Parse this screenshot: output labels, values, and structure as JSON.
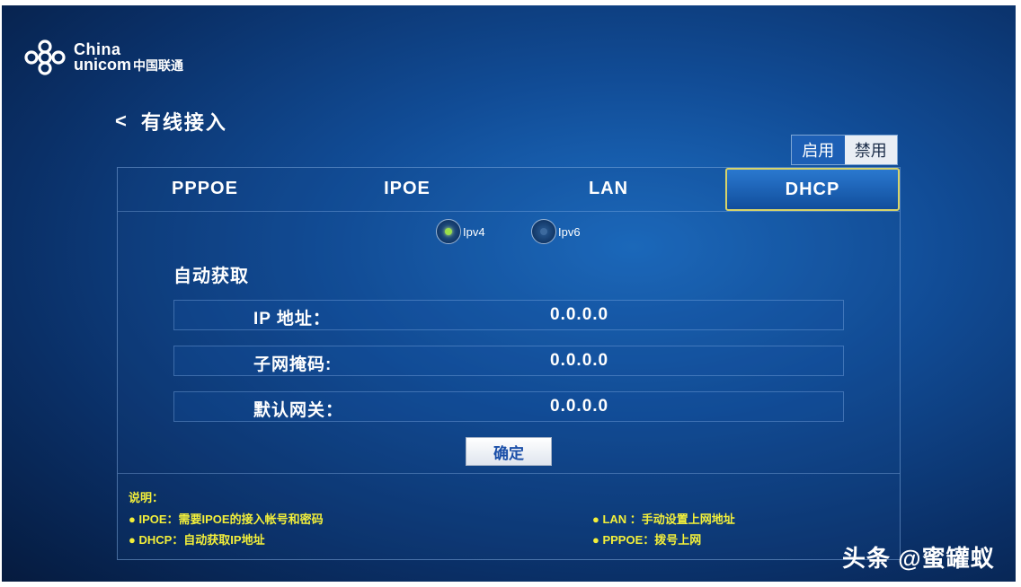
{
  "brand": {
    "line1": "China",
    "line2_en": "unicom",
    "line2_cn": "中国联通"
  },
  "header": {
    "back_glyph": "<",
    "title": "有线接入"
  },
  "toggle": {
    "enable_label": "启用",
    "disable_label": "禁用",
    "selected": "启用"
  },
  "tabs": [
    {
      "label": "PPPOE",
      "active": false
    },
    {
      "label": "IPOE",
      "active": false
    },
    {
      "label": "LAN",
      "active": false
    },
    {
      "label": "DHCP",
      "active": true
    }
  ],
  "ip_version": {
    "options": [
      {
        "label": "Ipv4",
        "selected": true
      },
      {
        "label": "Ipv6",
        "selected": false
      }
    ]
  },
  "section": {
    "title": "自动获取"
  },
  "fields": [
    {
      "label": "IP 地址：",
      "value": "0.0.0.0"
    },
    {
      "label": "子网掩码:",
      "value": "0.0.0.0"
    },
    {
      "label": "默认网关：",
      "value": "0.0.0.0"
    }
  ],
  "confirm_label": "确定",
  "notes": {
    "title": "说明：",
    "items": [
      "● IPOE：需要IPOE的接入帐号和密码",
      "● LAN ：手动设置上网地址",
      "● DHCP：自动获取IP地址",
      "● PPPOE：拨号上网"
    ]
  },
  "watermark": "头条 @蜜罐蚁",
  "colors": {
    "accent_blue": "#1d5fb5",
    "active_tab_border": "#d6d36a",
    "note_text": "#f3ef3a",
    "radio_selected": "#9be04a"
  }
}
